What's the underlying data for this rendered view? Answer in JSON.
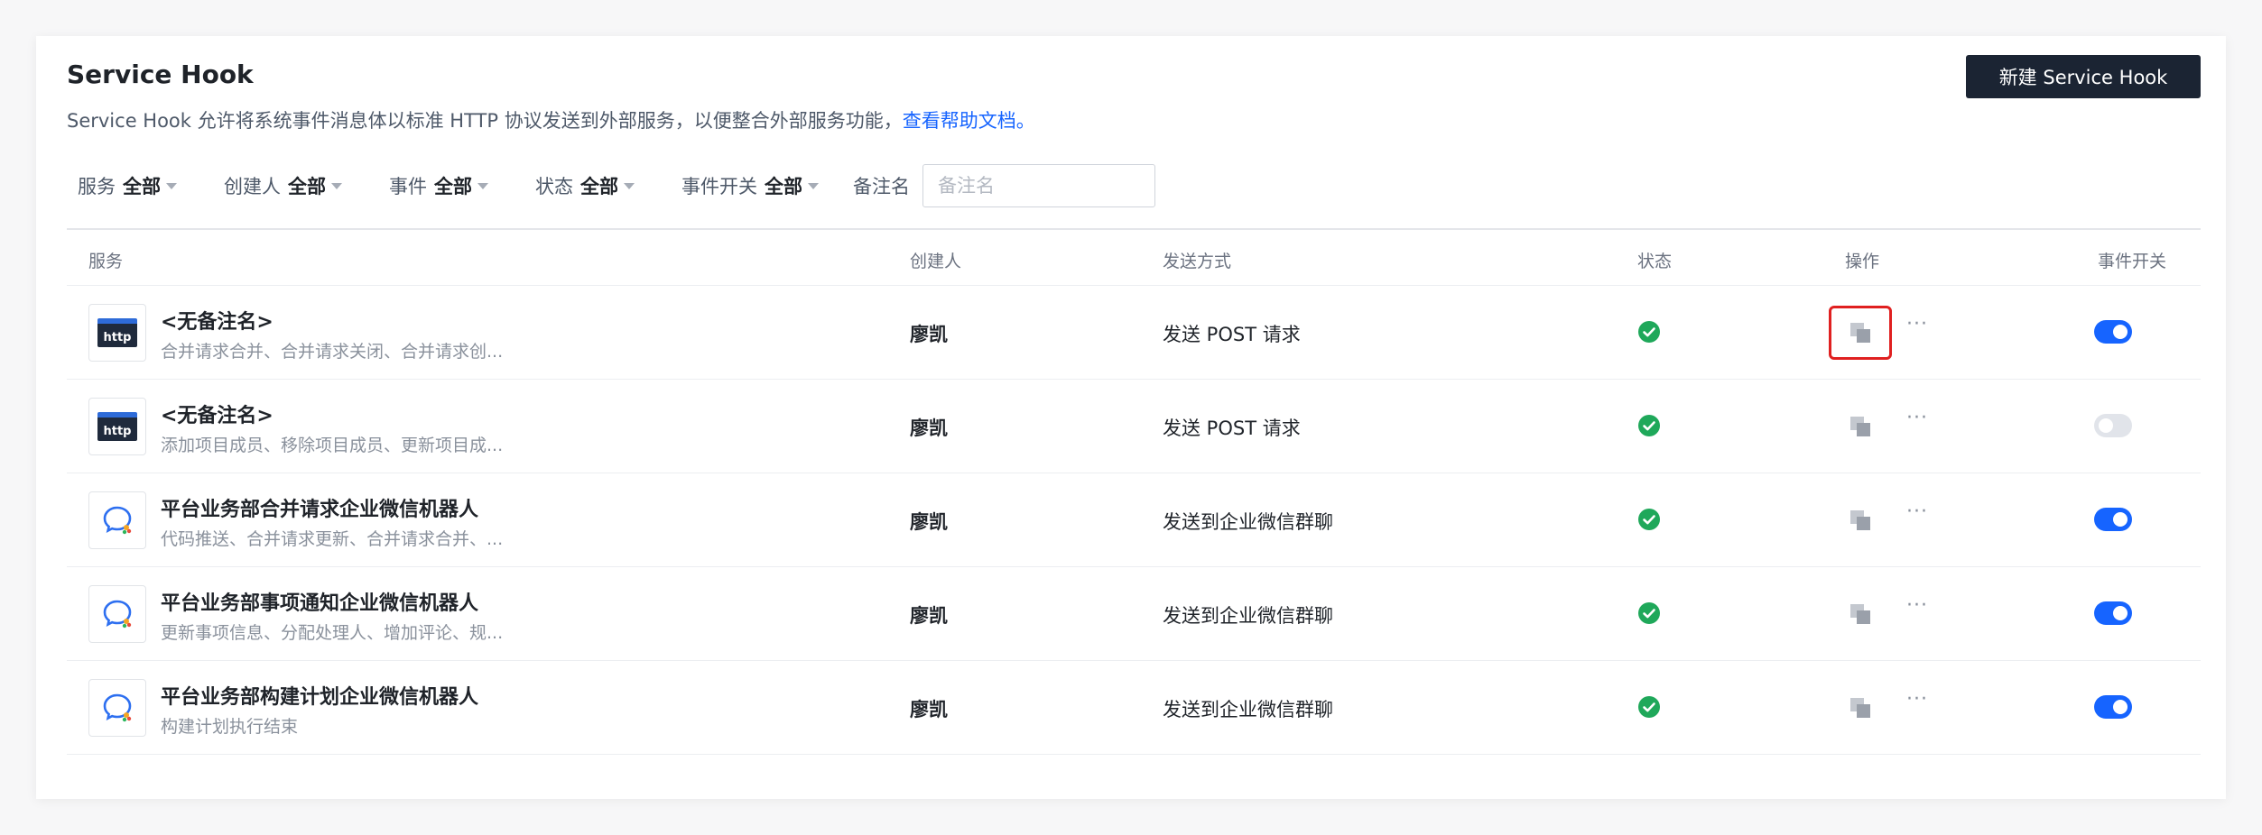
{
  "header": {
    "title": "Service Hook",
    "description": "Service Hook 允许将系统事件消息体以标准 HTTP 协议发送到外部服务，以便整合外部服务功能，",
    "help_link": "查看帮助文档。",
    "new_button": "新建 Service Hook"
  },
  "filters": [
    {
      "label": "服务",
      "value": "全部"
    },
    {
      "label": "创建人",
      "value": "全部"
    },
    {
      "label": "事件",
      "value": "全部"
    },
    {
      "label": "状态",
      "value": "全部"
    },
    {
      "label": "事件开关",
      "value": "全部"
    }
  ],
  "remark": {
    "label": "备注名",
    "placeholder": "备注名"
  },
  "columns": {
    "service": "服务",
    "creator": "创建人",
    "method": "发送方式",
    "status": "状态",
    "actions": "操作",
    "event_switch": "事件开关"
  },
  "rows": [
    {
      "icon": "http-icon",
      "name": "<无备注名>",
      "events": "合并请求合并、合并请求关闭、合并请求创...",
      "creator": "廖凯",
      "method": "发送 POST 请求",
      "status": "enabled",
      "switch_on": true,
      "highlight": true
    },
    {
      "icon": "http-icon",
      "name": "<无备注名>",
      "events": "添加项目成员、移除项目成员、更新项目成...",
      "creator": "廖凯",
      "method": "发送 POST 请求",
      "status": "enabled",
      "switch_on": false,
      "highlight": false
    },
    {
      "icon": "wecom-icon",
      "name": "平台业务部合并请求企业微信机器人",
      "events": "代码推送、合并请求更新、合并请求合并、...",
      "creator": "廖凯",
      "method": "发送到企业微信群聊",
      "status": "enabled",
      "switch_on": true,
      "highlight": false
    },
    {
      "icon": "wecom-icon",
      "name": "平台业务部事项通知企业微信机器人",
      "events": "更新事项信息、分配处理人、增加评论、规...",
      "creator": "廖凯",
      "method": "发送到企业微信群聊",
      "status": "enabled",
      "switch_on": true,
      "highlight": false
    },
    {
      "icon": "wecom-icon",
      "name": "平台业务部构建计划企业微信机器人",
      "events": "构建计划执行结束",
      "creator": "廖凯",
      "method": "发送到企业微信群聊",
      "status": "enabled",
      "switch_on": true,
      "highlight": false
    }
  ],
  "row_actions": {
    "more": "···"
  },
  "colors": {
    "accent": "#1664ff",
    "primary_button": "#1b2433",
    "success": "#1fa85a",
    "highlight_border": "#e02020",
    "toggle_off": "#e1e4ea"
  }
}
